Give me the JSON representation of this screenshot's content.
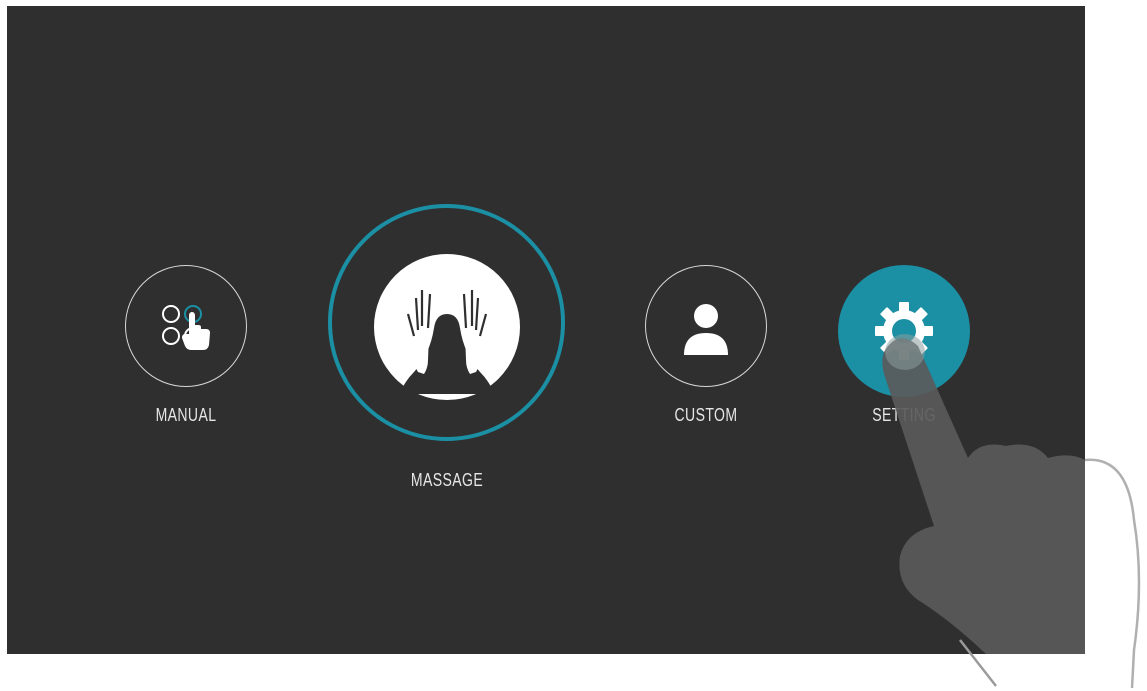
{
  "menu": {
    "manual": {
      "label": "MANUAL",
      "icon": "touch-select-icon"
    },
    "massage": {
      "label": "MASSAGE",
      "icon": "massage-hands-icon",
      "selected": true
    },
    "custom": {
      "label": "CUSTOM",
      "icon": "user-icon"
    },
    "setting": {
      "label": "SETTING",
      "icon": "gear-icon",
      "active": true
    }
  },
  "colors": {
    "background": "#2f2f2f",
    "accent": "#1b8fa3",
    "ring": "#d8d8d8",
    "text": "#e6e6e6"
  }
}
